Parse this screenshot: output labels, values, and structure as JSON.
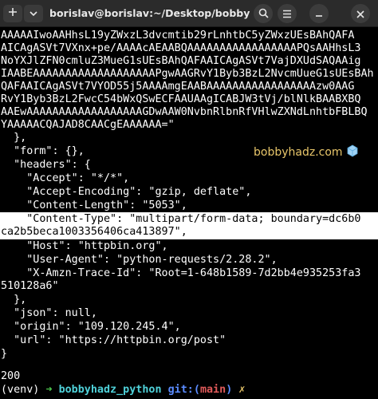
{
  "window": {
    "title": "borislav@borislav:~/Desktop/bobbyhadz_...",
    "icons": [
      "new-tab-icon",
      "dropdown-icon",
      "search-icon",
      "menu-icon",
      "minimize-icon",
      "close-icon"
    ]
  },
  "terminal": {
    "lines": [
      "AAAAAIwoAAHhsL19yZWxzL3dvcmtib29rLnhtbC5yZWxzUEsBAhQAFA",
      "AICAgASVt7VXnx+pe/AAAAcAEAABQAAAAAAAAAAAAAAAAAPQsAAHhsL3",
      "NoYXJlZFN0cmluZ3MueG1sUEsBAhQAFAAICAgASVt7VajDXUdSAQAAig",
      "IAABEAAAAAAAAAAAAAAAAAAAPgwAAGRvY1Byb3BzL2NvcmUueG1sUEsBAh",
      "QAFAAICAgASVt7VYOD55j5AAAAmgEAABAAAAAAAAAAAAAAAAAzw0AAG",
      "RvY1Byb3BzL2FwcC54bWxQSwECFAAUAAgICABJW3tVj/blNlkBAABXBQ",
      "AAEwAAAAAAAAAAAAAAAAAAGDwAAW0NvbnRlbnRfVHlwZXNdLnhtbFBLBQ",
      "YAAAAACQAJAD8CAACgEAAAAAA=\"",
      "  },",
      "  \"form\": {},",
      "  \"headers\": {",
      "    \"Accept\": \"*/*\",",
      "    \"Accept-Encoding\": \"gzip, deflate\",",
      "    \"Content-Length\": \"5053\",",
      "    \"Content-Type\": \"multipart/form-data; boundary=dc6b0",
      "ca2b5beca1003356406ca413897\",",
      "    \"Host\": \"httpbin.org\",",
      "    \"User-Agent\": \"python-requests/2.28.2\",",
      "    \"X-Amzn-Trace-Id\": \"Root=1-648b1589-7d2bb4e935253fa3",
      "510128a6\"",
      "  },",
      "  \"json\": null,",
      "  \"origin\": \"109.120.245.4\",",
      "  \"url\": \"https://httpbin.org/post\"",
      "}",
      "",
      "200"
    ],
    "prompt": {
      "venv": "(venv)",
      "arrow": "➜",
      "directory": "bobbyhadz_python",
      "git_label": "git:(",
      "branch": "main",
      "git_close": ")",
      "dirty": "✗"
    }
  },
  "watermark": {
    "text": "bobbyhadz.com"
  },
  "colors": {
    "titlebar": "#2b2b2b",
    "background": "#000000",
    "highlight": "#ffffff",
    "watermark": "#e8c66a",
    "prompt_arrow": "#4ec94e",
    "prompt_dir": "#4fd1d9",
    "prompt_git": "#5b8cff",
    "prompt_branch": "#e05a5a"
  }
}
